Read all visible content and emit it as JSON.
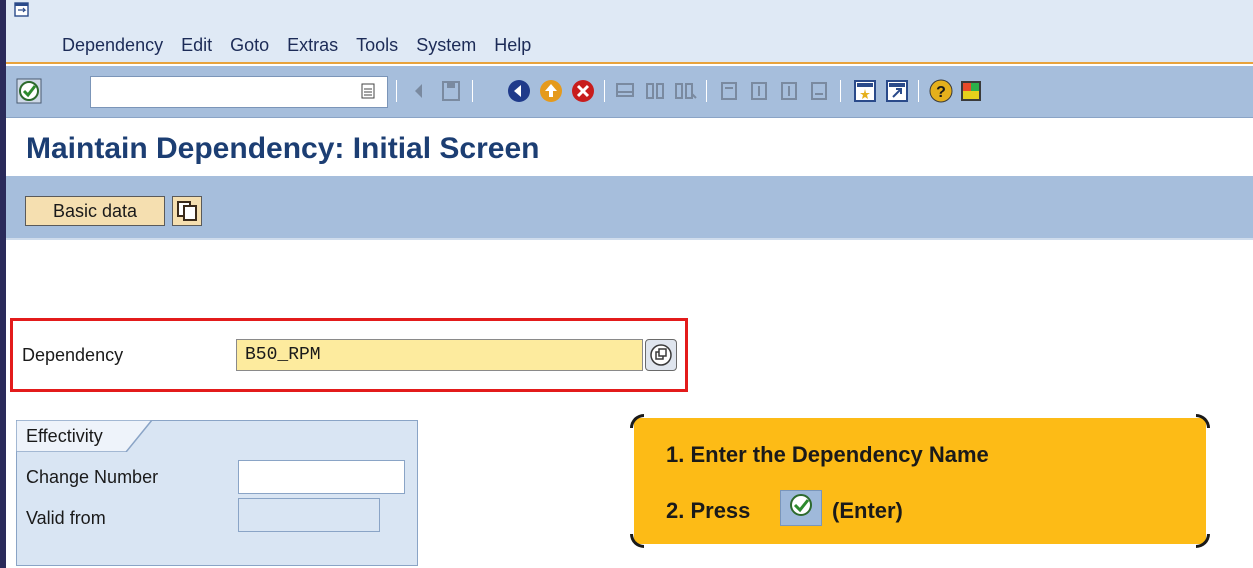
{
  "window": {
    "title": "Maintain Dependency: Initial Screen"
  },
  "menu": {
    "items": [
      {
        "label": "Dependency",
        "icon": "none"
      },
      {
        "label": "Edit"
      },
      {
        "label": "Goto"
      },
      {
        "label": "Extras"
      },
      {
        "label": "Tools"
      },
      {
        "label": "System"
      },
      {
        "label": "Help"
      }
    ]
  },
  "toolbar": {
    "command_field_value": "",
    "icons": [
      "enter-icon",
      "command-dropdown-icon",
      "back-arrow-icon",
      "save-icon",
      "back-icon",
      "exit-icon",
      "cancel-icon",
      "print-icon",
      "find-icon",
      "find-next-icon",
      "first-page-icon",
      "previous-page-icon",
      "next-page-icon",
      "last-page-icon",
      "create-session-icon",
      "shortcut-icon",
      "help-icon",
      "layout-icon"
    ]
  },
  "page_title": "Maintain Dependency: Initial Screen",
  "app_toolbar": {
    "basic_data_label": "Basic data"
  },
  "form": {
    "dependency": {
      "label": "Dependency",
      "value": "B50_RPM"
    },
    "effectivity": {
      "title": "Effectivity",
      "change_number": {
        "label": "Change Number",
        "value": ""
      },
      "valid_from": {
        "label": "Valid from",
        "value": ""
      }
    }
  },
  "callout": {
    "line1": "1. Enter the Dependency Name",
    "line2_prefix": "2. Press",
    "line2_suffix": "(Enter)"
  },
  "colors": {
    "menu_bg": "#dfe9f5",
    "toolbar_bg": "#a6bedc",
    "title_text": "#1c3e73",
    "required_field_bg": "#fdeb9e",
    "highlight_border": "#e31b1b",
    "callout_bg": "#fdbb16"
  }
}
